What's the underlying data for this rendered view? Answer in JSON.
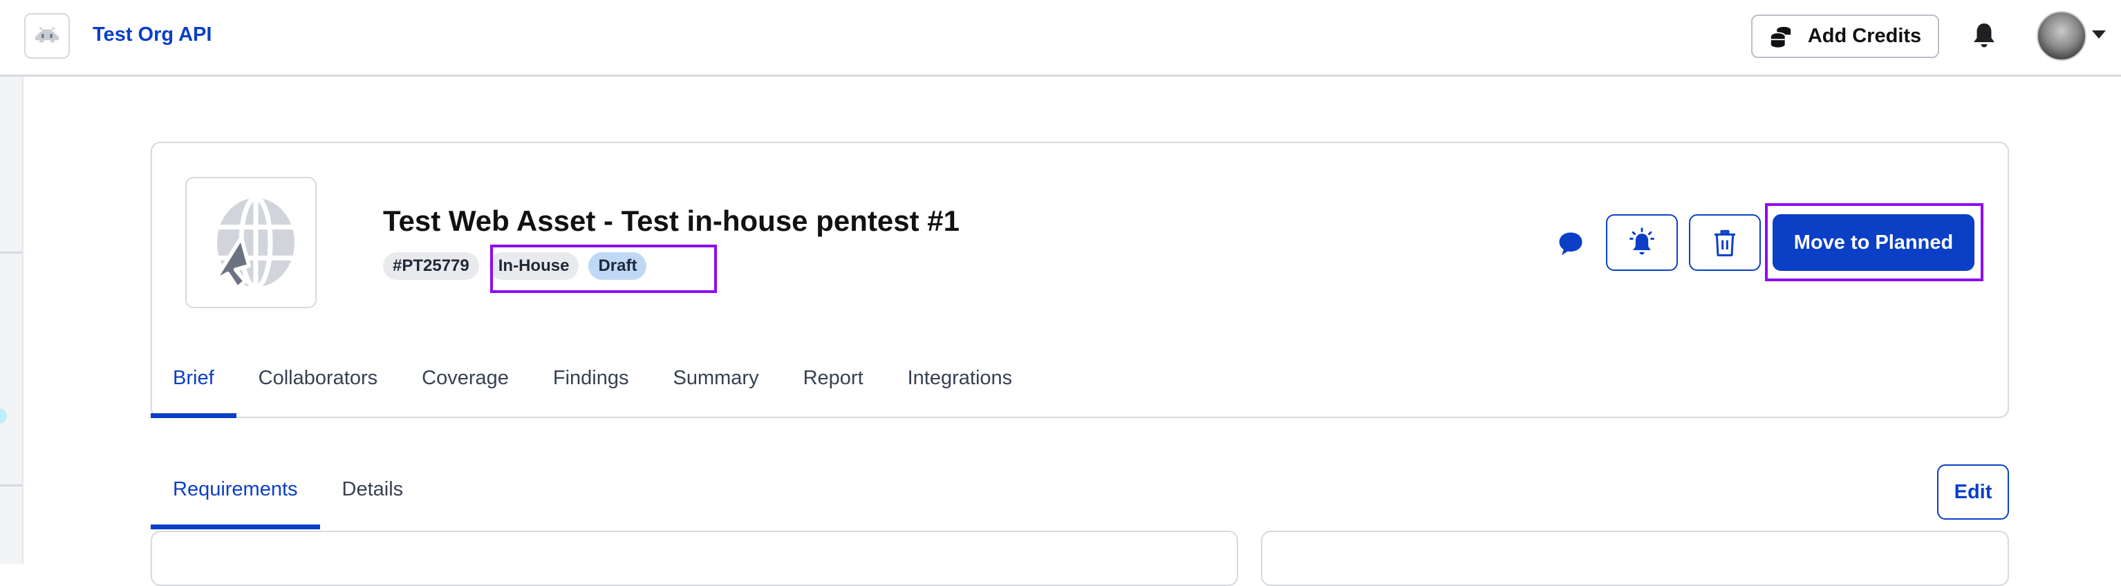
{
  "header": {
    "org_logo_icon": "space-invader-icon",
    "org_name": "Test Org API",
    "add_credits_label": "Add Credits",
    "add_credits_icon": "coins-icon",
    "notifications_icon": "bell-icon",
    "avatar_icon": "user-avatar",
    "account_menu_icon": "caret-down-icon"
  },
  "asset": {
    "icon": "web-asset-globe-cursor-icon",
    "title": "Test Web Asset - Test in-house pentest #1",
    "badges": [
      {
        "label": "#PT25779",
        "kind": "id"
      },
      {
        "label": "In-House",
        "kind": "type"
      },
      {
        "label": "Draft",
        "kind": "status"
      }
    ],
    "actions": {
      "comment_icon": "comment-icon",
      "notify_icon": "bell-alert-icon",
      "delete_icon": "trash-icon",
      "primary_label": "Move to Planned"
    }
  },
  "tabs": [
    {
      "label": "Brief",
      "active": true
    },
    {
      "label": "Collaborators",
      "active": false
    },
    {
      "label": "Coverage",
      "active": false
    },
    {
      "label": "Findings",
      "active": false
    },
    {
      "label": "Summary",
      "active": false
    },
    {
      "label": "Report",
      "active": false
    },
    {
      "label": "Integrations",
      "active": false
    }
  ],
  "subtabs": [
    {
      "label": "Requirements",
      "active": true
    },
    {
      "label": "Details",
      "active": false
    }
  ],
  "edit_label": "Edit",
  "colors": {
    "brand": "#0a3fc6",
    "highlight": "#8e0bf3",
    "draft_badge": "#bfd8f5",
    "neutral_badge": "#e9eaee"
  }
}
